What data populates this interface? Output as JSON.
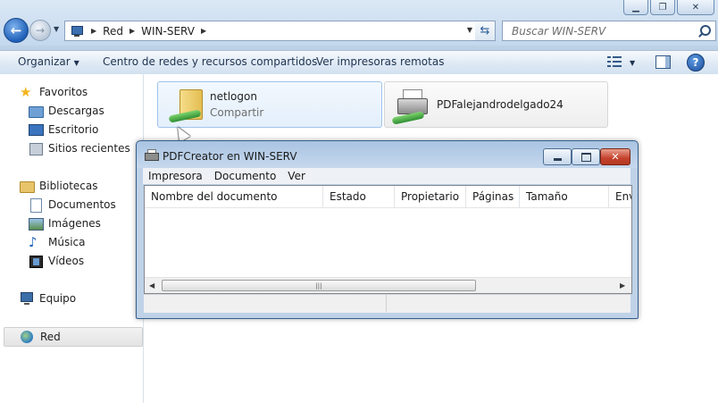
{
  "explorer": {
    "breadcrumb": [
      "Red",
      "WIN-SERV"
    ],
    "search_placeholder": "Buscar WIN-SERV",
    "toolbar": {
      "organize": "Organizar",
      "network_center": "Centro de redes y recursos compartidos",
      "remote_printers": "Ver impresoras remotas"
    },
    "nav": {
      "favorites": "Favoritos",
      "downloads": "Descargas",
      "desktop": "Escritorio",
      "recent": "Sitios recientes",
      "libraries": "Bibliotecas",
      "documents": "Documentos",
      "images": "Imágenes",
      "music": "Música",
      "videos": "Vídeos",
      "computer": "Equipo",
      "network": "Red"
    },
    "items": [
      {
        "name": "netlogon",
        "subtitle": "Compartir"
      },
      {
        "name": "PDFalejandrodelgado24"
      }
    ],
    "icons": [
      "back-arrow-icon",
      "forward-arrow-icon",
      "refresh-icon",
      "search-icon",
      "help-icon"
    ]
  },
  "dialog": {
    "title": "PDFCreator en WIN-SERV",
    "menus": [
      "Impresora",
      "Documento",
      "Ver"
    ],
    "columns": [
      "Nombre del documento",
      "Estado",
      "Propietario",
      "Páginas",
      "Tamaño",
      "Env"
    ],
    "rows": []
  }
}
